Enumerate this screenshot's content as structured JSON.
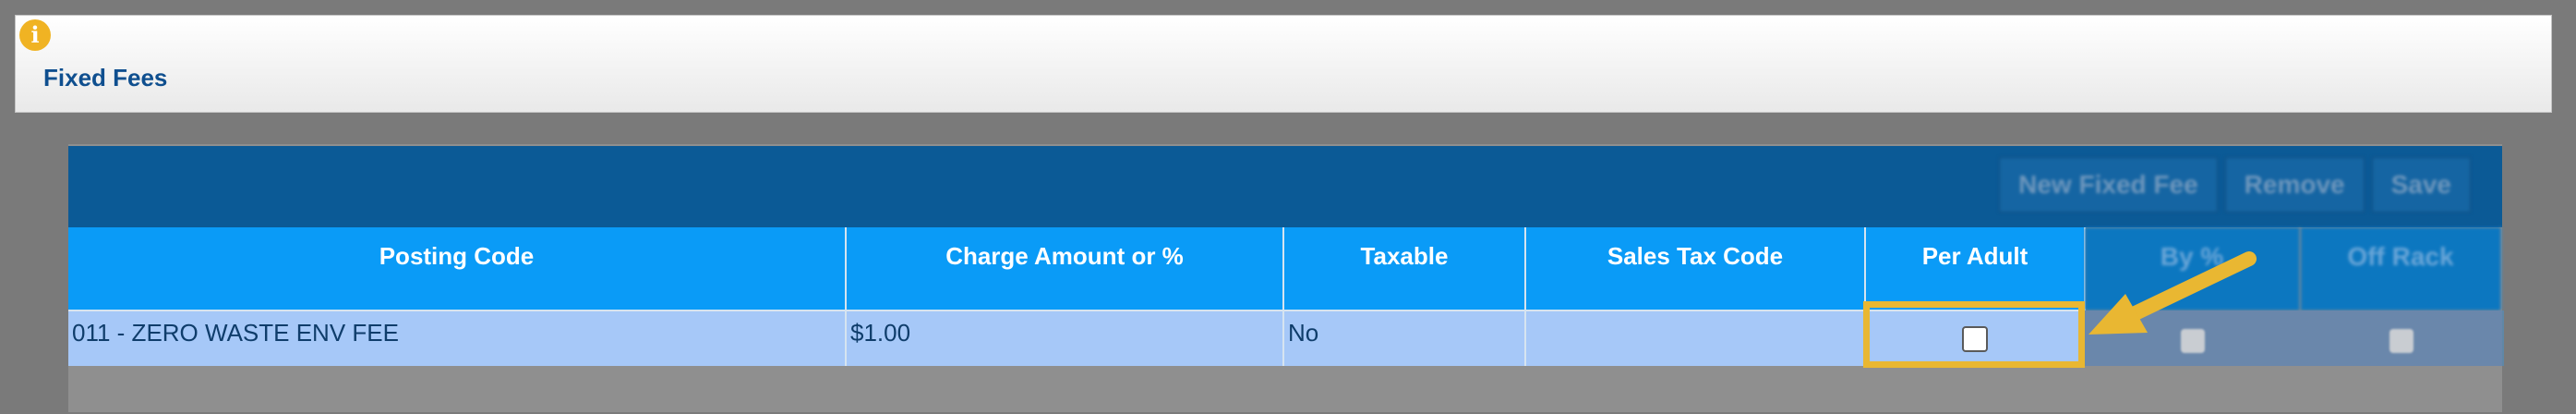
{
  "page": {
    "title": "Fixed Fees",
    "info_icon": "info-icon"
  },
  "toolbar": {
    "new_label": "New Fixed Fee",
    "remove_label": "Remove",
    "save_label": "Save"
  },
  "table": {
    "columns": [
      "Posting Code",
      "Charge Amount or %",
      "Taxable",
      "Sales Tax Code",
      "Per Adult",
      "By %",
      "Off Rack"
    ],
    "rows": [
      {
        "posting_code": "011 - ZERO WASTE ENV FEE",
        "charge_amount": "$1.00",
        "taxable": "No",
        "sales_tax_code": "",
        "per_adult": false,
        "by_percent": false,
        "off_rack": false
      }
    ]
  },
  "annotation": {
    "highlight_color": "#e9b732",
    "target": "Per Adult checkbox"
  },
  "colors": {
    "header_blue": "#0a9bf7",
    "toolbar_blue": "#0b5a96",
    "row_blue": "#a6c8f8",
    "title_blue": "#0f4f8f"
  }
}
